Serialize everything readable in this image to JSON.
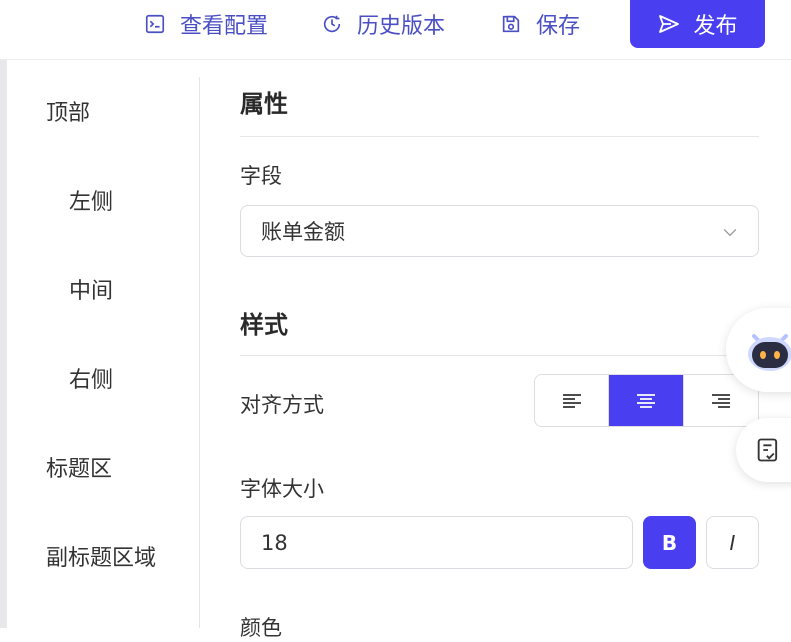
{
  "toolbar": {
    "view_config": "查看配置",
    "history": "历史版本",
    "save": "保存",
    "publish": "发布"
  },
  "nav": {
    "items": [
      {
        "label": "顶部",
        "indent": false
      },
      {
        "label": "左侧",
        "indent": true
      },
      {
        "label": "中间",
        "indent": true
      },
      {
        "label": "右侧",
        "indent": true
      },
      {
        "label": "标题区",
        "indent": false
      },
      {
        "label": "副标题区域",
        "indent": false
      }
    ]
  },
  "properties": {
    "title": "属性",
    "field_label": "字段",
    "field_value": "账单金额"
  },
  "style": {
    "title": "样式",
    "align_label": "对齐方式",
    "align_selected": "center",
    "font_size_label": "字体大小",
    "font_size_value": "18",
    "bold_label": "B",
    "italic_label": "I",
    "bold_active": true,
    "color_label": "颜色"
  },
  "colors": {
    "accent": "#4a3ff0",
    "toolbar_text": "#4a4fc4"
  }
}
